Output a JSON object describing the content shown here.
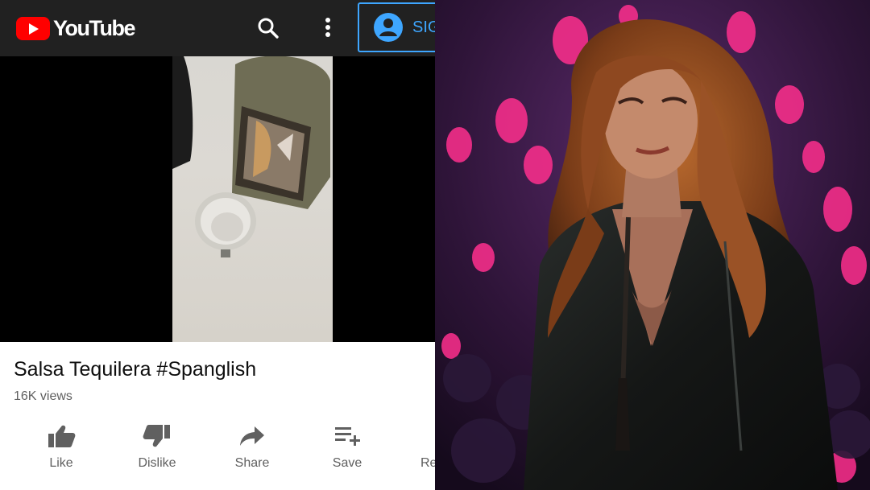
{
  "app": {
    "brand": "YouTube",
    "accent": "#ff0000",
    "topbar_color": "#212121"
  },
  "header": {
    "icons": [
      "search-icon",
      "more-vert-icon",
      "account-icon"
    ],
    "signin_label": "SIG"
  },
  "video": {
    "title": "Salsa Tequilera #Spanglish",
    "views": "16K views"
  },
  "actions": [
    {
      "label": "Like",
      "icon": "thumb-up-icon"
    },
    {
      "label": "Dislike",
      "icon": "thumb-down-icon"
    },
    {
      "label": "Share",
      "icon": "share-icon"
    },
    {
      "label": "Save",
      "icon": "playlist-add-icon"
    },
    {
      "label": "Re",
      "icon": "report-icon"
    }
  ],
  "photo": {
    "subject": "performer-on-stage"
  }
}
